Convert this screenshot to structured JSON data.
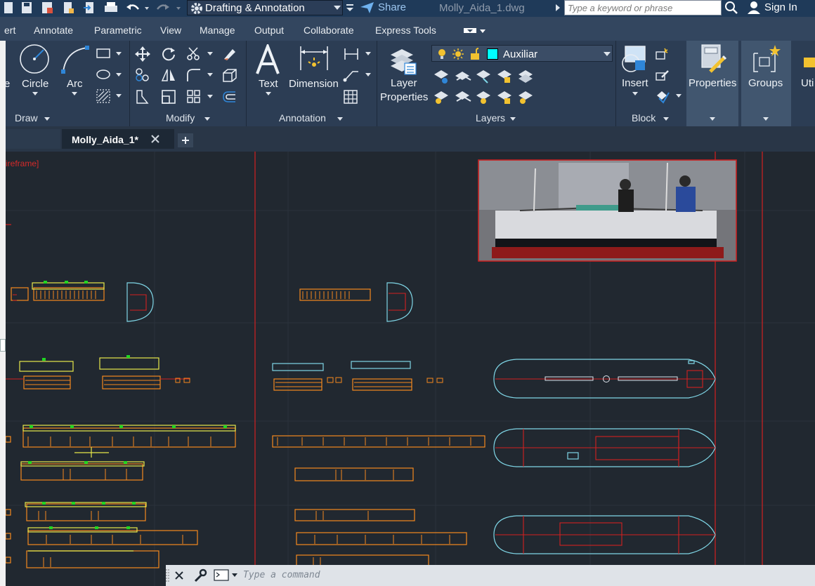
{
  "app": {
    "workspace": "Drafting & Annotation",
    "share_label": "Share",
    "document_title": "Molly_Aida_1.dwg",
    "search_placeholder": "Type a keyword or phrase",
    "sign_in_label": "Sign In"
  },
  "ribbon_tabs": [
    "ert",
    "Annotate",
    "Parametric",
    "View",
    "Manage",
    "Output",
    "Collaborate",
    "Express Tools"
  ],
  "ribbon": {
    "draw": {
      "panel_label": "Draw",
      "tools": [
        "e",
        "Circle",
        "Arc"
      ]
    },
    "modify": {
      "panel_label": "Modify"
    },
    "annotation": {
      "panel_label": "Annotation",
      "tools": [
        "Text",
        "Dimension"
      ]
    },
    "layers": {
      "panel_label": "Layers",
      "layer_properties_line1": "Layer",
      "layer_properties_line2": "Properties",
      "current_layer": "Auxiliar",
      "current_layer_color": "#00ffff"
    },
    "block": {
      "panel_label": "Block",
      "tools": [
        "Insert"
      ]
    },
    "properties_label": "Properties",
    "groups_label": "Groups",
    "utilities_label": "Uti"
  },
  "file_tab": {
    "label": "Molly_Aida_1*"
  },
  "viewport_controls": "ireframe]",
  "command_line": {
    "placeholder": "Type a command"
  },
  "colors": {
    "accent": "#2f86d8",
    "canvas_bg": "#212830",
    "line_orange": "#f5891e",
    "line_cyan": "#7fd6e6",
    "line_red": "#d32020",
    "line_yellow": "#e8e84a",
    "line_green": "#21d621"
  },
  "icons": [
    "save-icon",
    "save-as-icon",
    "plot-icon",
    "undo-icon",
    "redo-icon",
    "gear-icon",
    "share-icon",
    "search-icon",
    "user-icon",
    "circle-icon",
    "arc-icon",
    "move-icon",
    "rotate-icon",
    "trim-icon",
    "copy-icon",
    "mirror-icon",
    "fillet-icon",
    "stretch-icon",
    "scale-icon",
    "array-icon",
    "text-icon",
    "dimension-icon",
    "layer-properties-icon",
    "light-bulb-icon",
    "sun-icon",
    "lock-icon",
    "insert-icon",
    "properties-icon",
    "groups-icon",
    "close-icon",
    "plus-icon",
    "wrench-icon",
    "terminal-icon"
  ]
}
